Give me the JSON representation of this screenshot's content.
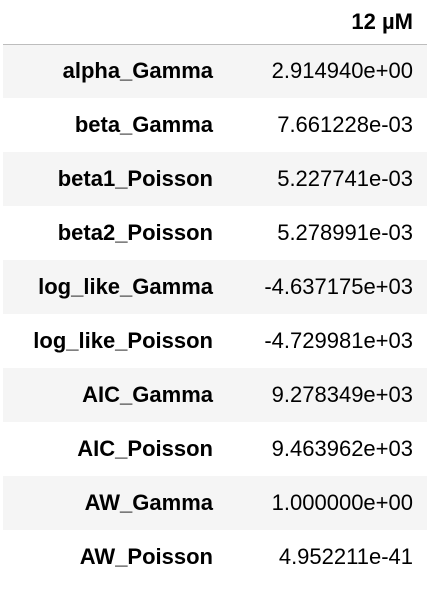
{
  "table": {
    "columns": [
      "",
      "12 µM"
    ],
    "rows": [
      {
        "label": "alpha_Gamma",
        "value": "2.914940e+00"
      },
      {
        "label": "beta_Gamma",
        "value": "7.661228e-03"
      },
      {
        "label": "beta1_Poisson",
        "value": "5.227741e-03"
      },
      {
        "label": "beta2_Poisson",
        "value": "5.278991e-03"
      },
      {
        "label": "log_like_Gamma",
        "value": "-4.637175e+03"
      },
      {
        "label": "log_like_Poisson",
        "value": "-4.729981e+03"
      },
      {
        "label": "AIC_Gamma",
        "value": "9.278349e+03"
      },
      {
        "label": "AIC_Poisson",
        "value": "9.463962e+03"
      },
      {
        "label": "AW_Gamma",
        "value": "1.000000e+00"
      },
      {
        "label": "AW_Poisson",
        "value": "4.952211e-41"
      }
    ]
  }
}
